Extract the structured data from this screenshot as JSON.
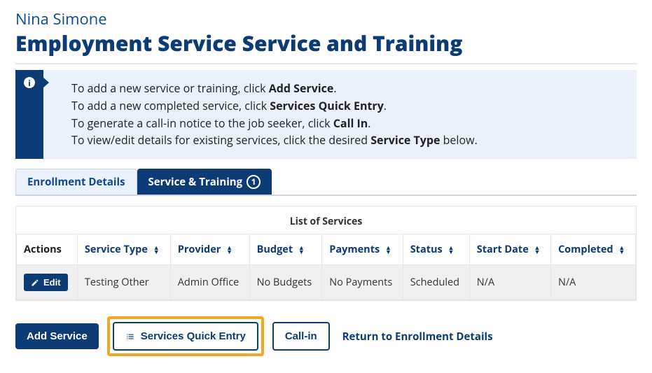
{
  "header": {
    "subtitle": "Nina Simone",
    "title": "Employment Service Service and Training"
  },
  "info_box": {
    "lines": [
      {
        "prefix": "To add a new service or training, click ",
        "bold": "Add Service",
        "suffix": "."
      },
      {
        "prefix": "To add a new completed service, click ",
        "bold": "Services Quick Entry",
        "suffix": "."
      },
      {
        "prefix": "To generate a call-in notice to the job seeker, click ",
        "bold": "Call In",
        "suffix": "."
      },
      {
        "prefix": "To view/edit details for existing services, click the desired ",
        "bold": "Service Type",
        "suffix": " below."
      }
    ]
  },
  "tabs": {
    "enrollment": {
      "label": "Enrollment Details"
    },
    "service_training": {
      "label": "Service & Training",
      "count": "1"
    }
  },
  "table": {
    "title": "List of Services",
    "columns": {
      "actions": "Actions",
      "service_type": "Service Type",
      "provider": "Provider",
      "budget": "Budget",
      "payments": "Payments",
      "status": "Status",
      "start_date": "Start Date",
      "completed": "Completed"
    },
    "rows": [
      {
        "edit_label": "Edit",
        "service_type": "Testing Other",
        "provider": "Admin Office",
        "budget": "No Budgets",
        "payments": "No Payments",
        "status": "Scheduled",
        "start_date": "N/A",
        "completed": "N/A"
      }
    ]
  },
  "actions": {
    "add_service": "Add Service",
    "services_quick_entry": "Services Quick Entry",
    "call_in": "Call-in",
    "return_link": "Return to Enrollment Details"
  }
}
